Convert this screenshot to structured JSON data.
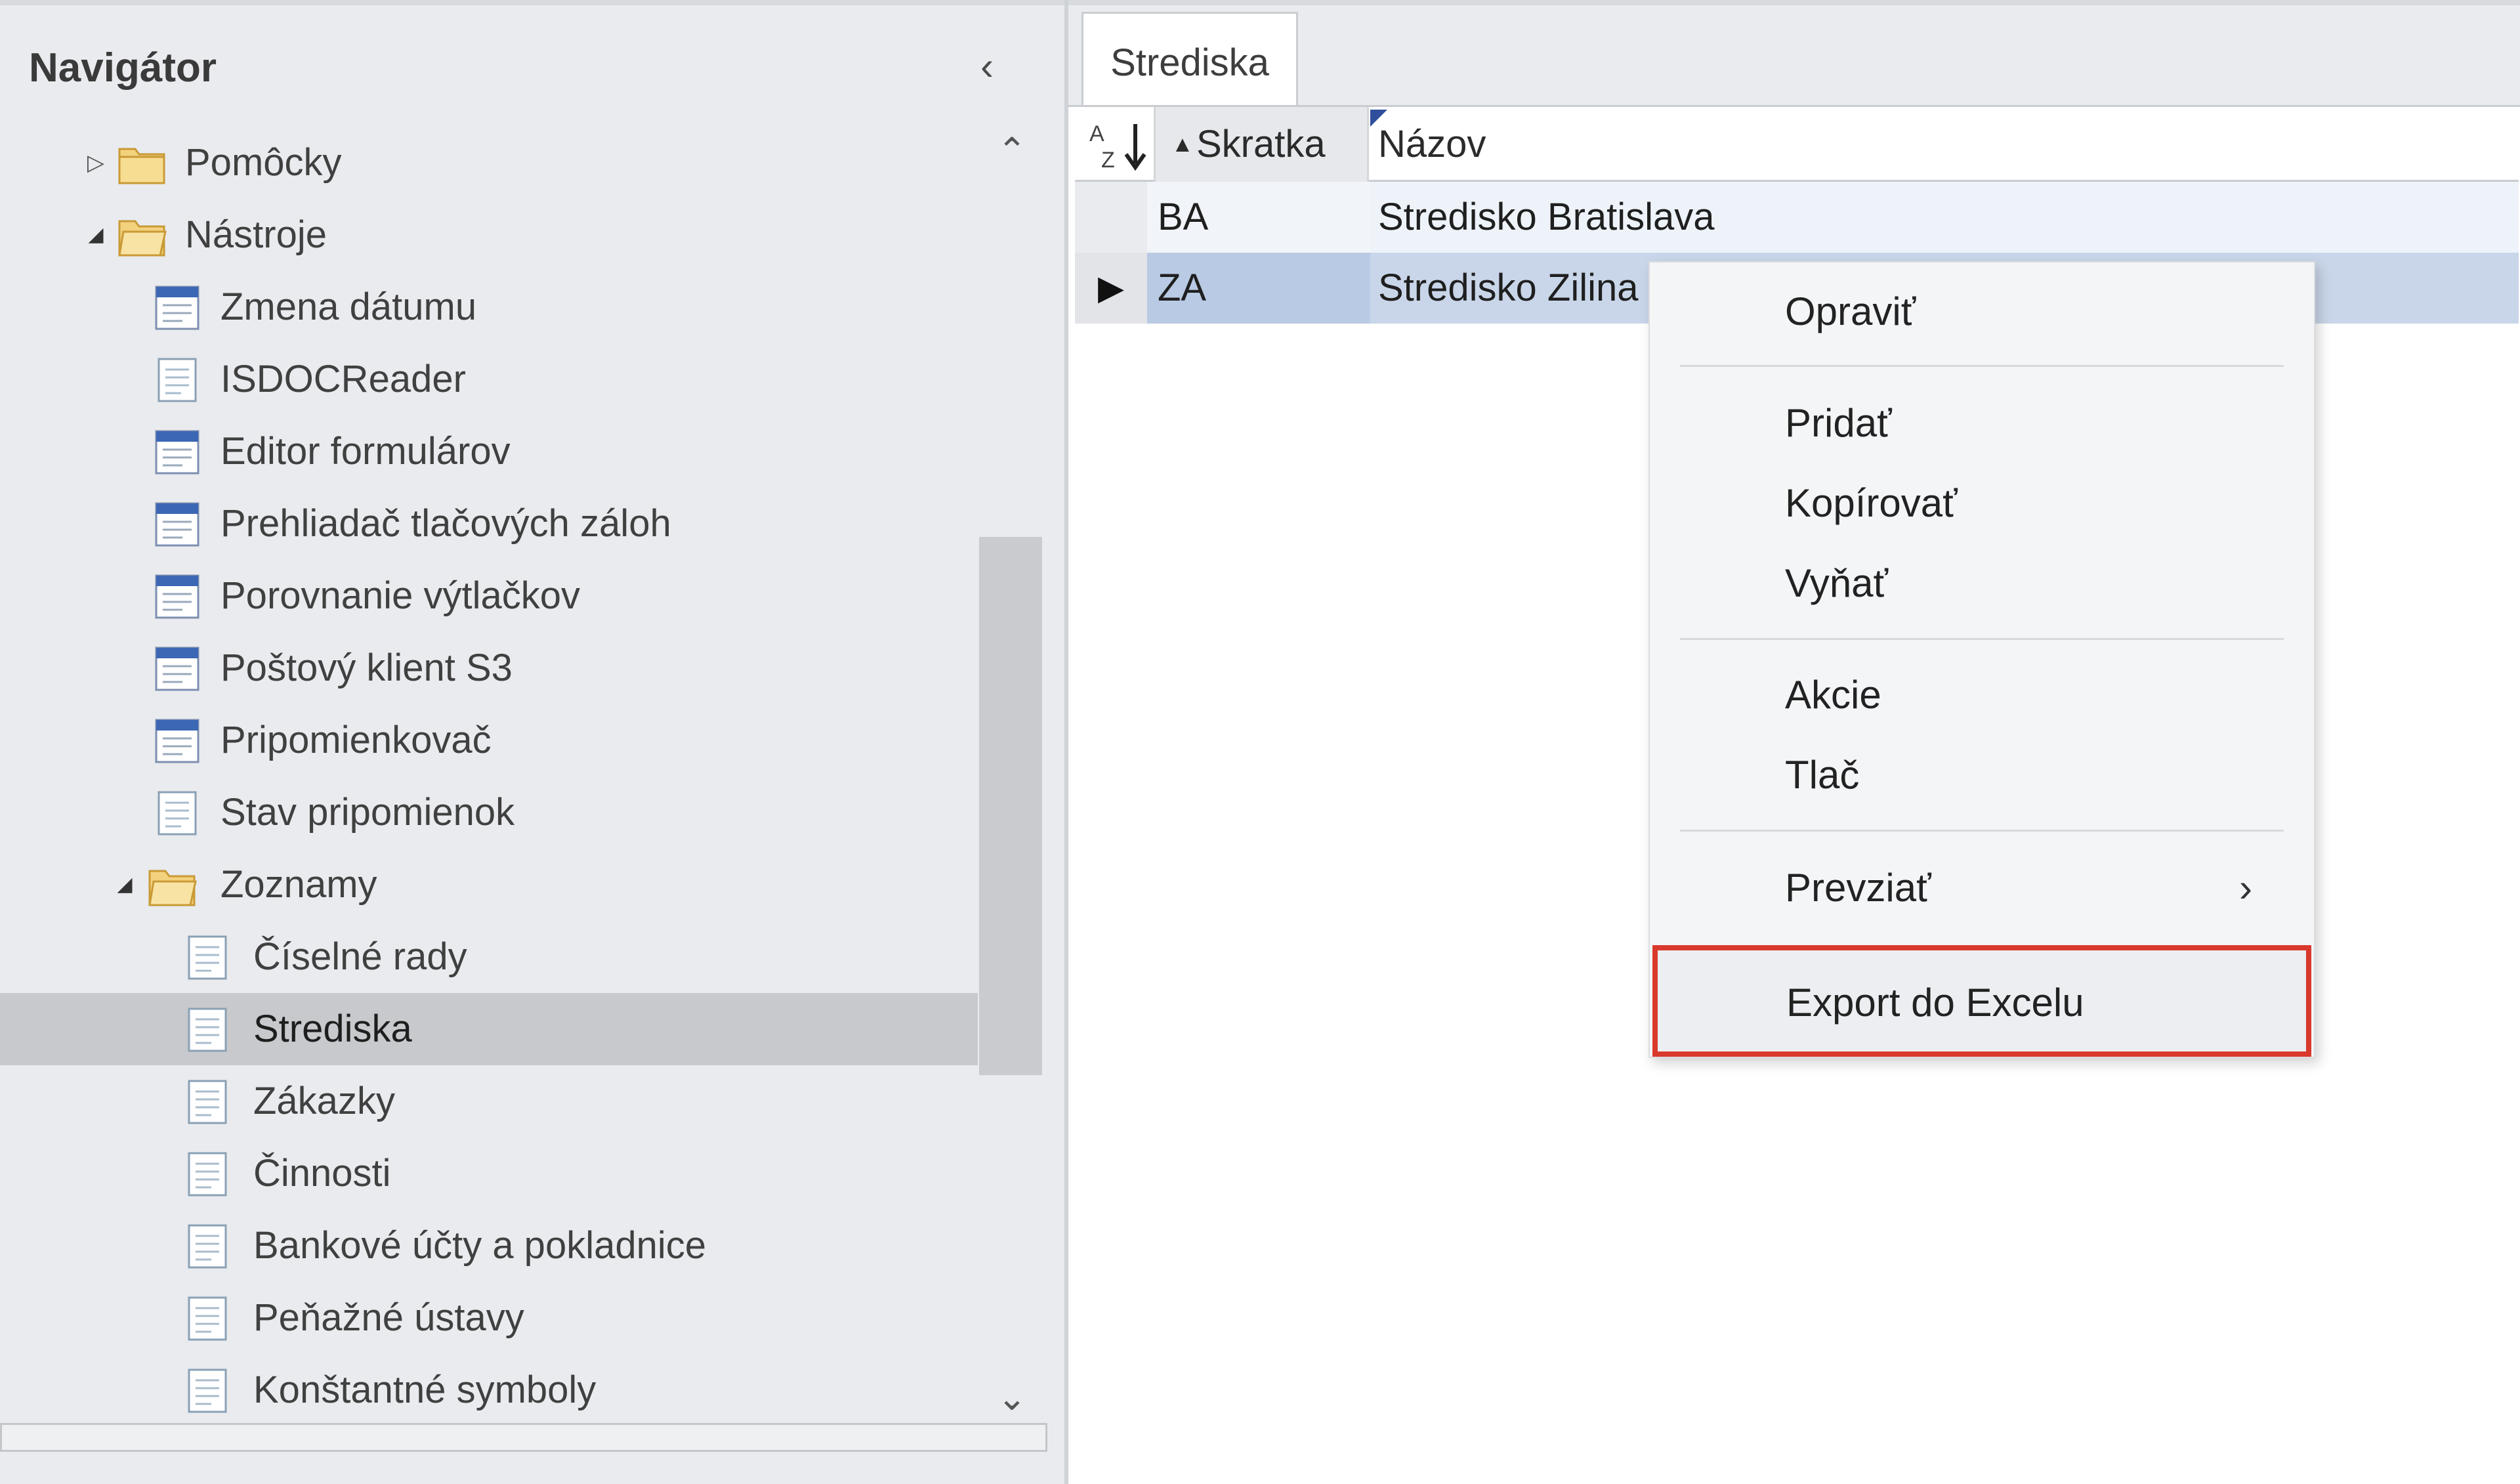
{
  "navigator": {
    "title": "Navigátor",
    "collapse_glyph": "‹",
    "items": [
      {
        "label": "Pomôcky",
        "type": "folder",
        "expander": "collapsed"
      },
      {
        "label": "Nástroje",
        "type": "folder",
        "expander": "expanded"
      },
      {
        "label": "Zmena dátumu",
        "type": "app"
      },
      {
        "label": "ISDOCReader",
        "type": "doc"
      },
      {
        "label": "Editor formulárov",
        "type": "app"
      },
      {
        "label": "Prehliadač tlačových záloh",
        "type": "app"
      },
      {
        "label": "Porovnanie výtlačkov",
        "type": "app"
      },
      {
        "label": "Poštový klient S3",
        "type": "app"
      },
      {
        "label": "Pripomienkovač",
        "type": "app"
      },
      {
        "label": "Stav pripomienok",
        "type": "doc"
      },
      {
        "label": "Zoznamy",
        "type": "folder",
        "expander": "expanded"
      },
      {
        "label": "Číselné rady",
        "type": "doc"
      },
      {
        "label": "Strediska",
        "type": "doc",
        "selected": true
      },
      {
        "label": "Zákazky",
        "type": "doc"
      },
      {
        "label": "Činnosti",
        "type": "doc"
      },
      {
        "label": "Bankové účty a pokladnice",
        "type": "doc"
      },
      {
        "label": "Peňažné ústavy",
        "type": "doc"
      },
      {
        "label": "Konštantné symboly",
        "type": "doc"
      }
    ]
  },
  "tabs": [
    {
      "label": "Strediska",
      "active": true
    }
  ],
  "grid": {
    "columns": [
      {
        "label": "Skratka",
        "sorted": "ascending"
      },
      {
        "label": "Názov"
      }
    ],
    "rows": [
      {
        "code": "BA",
        "name": "Stredisko Bratislava",
        "selected": false
      },
      {
        "code": "ZA",
        "name": "Stredisko Zilina",
        "selected": true
      }
    ]
  },
  "context_menu": {
    "items": [
      {
        "label": "Opraviť"
      },
      {
        "label": "Pridať"
      },
      {
        "label": "Kopírovať"
      },
      {
        "label": "Vyňať"
      },
      {
        "label": "Akcie"
      },
      {
        "label": "Tlač"
      },
      {
        "label": "Prevziať",
        "has_submenu": true
      },
      {
        "label": "Export do Excelu",
        "highlighted": true
      }
    ],
    "highlight_color": "#d9392c"
  }
}
